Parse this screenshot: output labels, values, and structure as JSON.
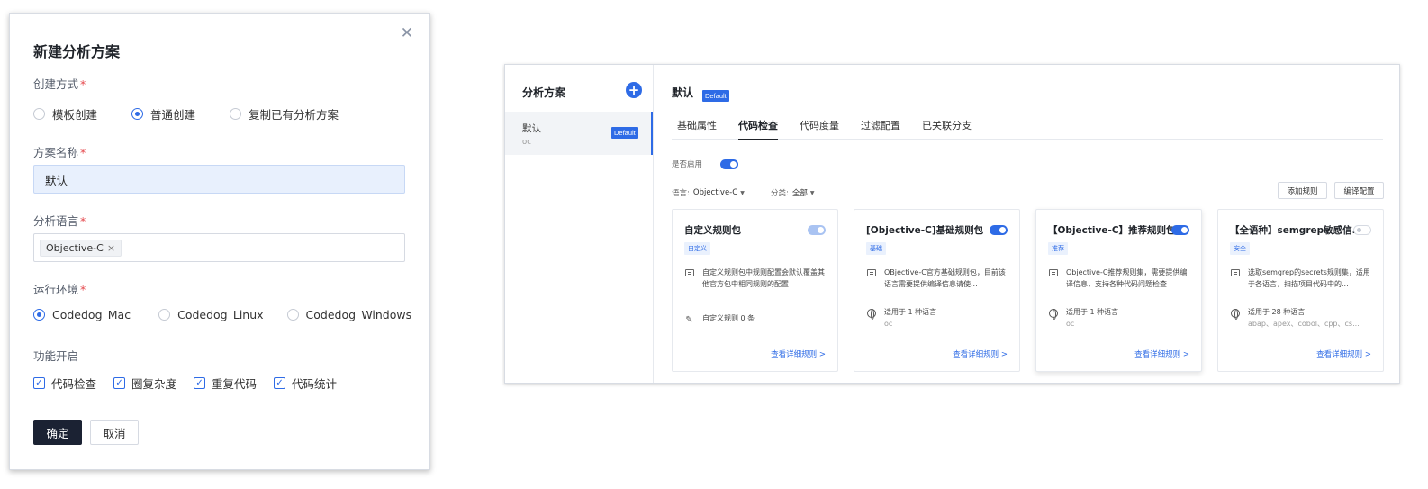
{
  "dialog": {
    "title": "新建分析方案",
    "close_icon": "close-icon",
    "create_mode": {
      "label": "创建方式",
      "options": [
        "模板创建",
        "普通创建",
        "复制已有分析方案"
      ],
      "selected": "普通创建"
    },
    "name": {
      "label": "方案名称",
      "value": "默认"
    },
    "language": {
      "label": "分析语言",
      "tags": [
        "Objective-C"
      ],
      "remove_glyph": "×"
    },
    "env": {
      "label": "运行环境",
      "options": [
        "Codedog_Mac",
        "Codedog_Linux",
        "Codedog_Windows"
      ],
      "selected": "Codedog_Mac"
    },
    "features": {
      "label": "功能开启",
      "items": [
        "代码检查",
        "圈复杂度",
        "重复代码",
        "代码统计"
      ],
      "check_glyph": "✓"
    },
    "required_mark": "*",
    "ok_label": "确定",
    "cancel_label": "取消"
  },
  "panel": {
    "sidebar": {
      "title": "分析方案",
      "add_glyph": "+",
      "items": [
        {
          "name": "默认",
          "sub": "oc",
          "badge": "Default"
        }
      ]
    },
    "title": "默认",
    "badge": "Default",
    "tabs": [
      "基础属性",
      "代码检查",
      "代码度量",
      "过滤配置",
      "已关联分支"
    ],
    "active_tab": "代码检查",
    "enable_label": "是否启用",
    "enabled": true,
    "filters": {
      "language_label": "语言:",
      "language_value": "Objective-C",
      "category_label": "分类:",
      "category_value": "全部",
      "caret_glyph": "▼"
    },
    "add_rule_label": "添加规则",
    "compile_config_label": "编译配置",
    "cards": [
      {
        "title": "自定义规则包",
        "tag": "自定义",
        "desc": "自定义规则包中规则配置会默认覆盖其他官方包中相同规则的配置",
        "info": "自定义规则 0 条",
        "info_sub": "",
        "info_icon": "edit-icon",
        "toggle": "light",
        "link": "查看详细规则 >"
      },
      {
        "title": "[Objective-C]基础规则包",
        "tag": "基础",
        "desc": "OBjective-C官方基础规则包，目前该语言需要提供编译信息请使...",
        "info": "适用于 1 种语言",
        "info_sub": "oc",
        "info_icon": "globe-icon",
        "toggle": "on",
        "link": "查看详细规则 >"
      },
      {
        "title": "【Objective-C】推荐规则包",
        "tag": "推荐",
        "desc": "Objective-C推荐规则集，需要提供编译信息，支持各种代码问题检查",
        "info": "适用于 1 种语言",
        "info_sub": "oc",
        "info_icon": "globe-icon",
        "toggle": "on",
        "link": "查看详细规则 >"
      },
      {
        "title": "【全语种】semgrep敏感信...",
        "tag": "安全",
        "desc": "选取semgrep的secrets规则集，适用于各语言，扫描项目代码中的...",
        "info": "适用于 28 种语言",
        "info_sub": "abap、apex、cobol、cpp、cs...",
        "info_icon": "globe-icon",
        "toggle": "off",
        "link": "查看详细规则 >"
      }
    ]
  }
}
